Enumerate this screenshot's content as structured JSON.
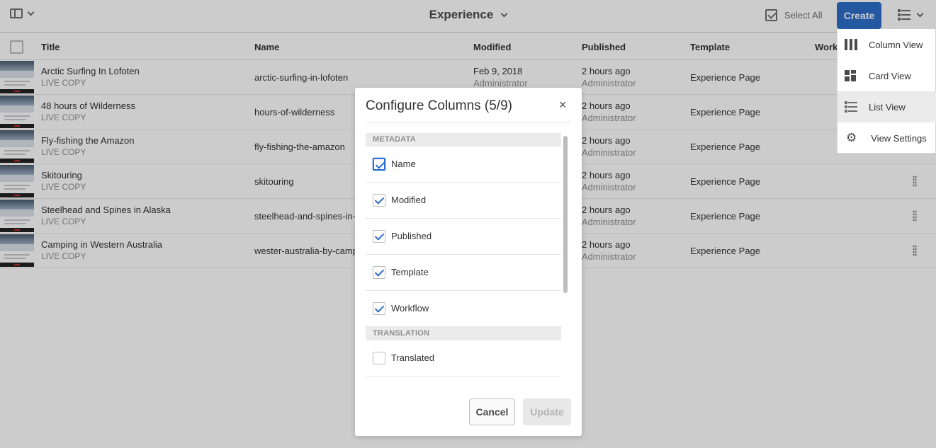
{
  "header": {
    "title": "Experience",
    "select_all": "Select All",
    "create": "Create"
  },
  "table": {
    "columns": [
      "Title",
      "Name",
      "Modified",
      "Published",
      "Template",
      "Workflow"
    ],
    "rows": [
      {
        "title": "Arctic Surfing In Lofoten",
        "sub": "LIVE COPY",
        "name": "arctic-surfing-in-lofoten",
        "modified": "Feb 9, 2018",
        "modified_by": "Administrator",
        "published": "2 hours ago",
        "published_by": "Administrator",
        "template": "Experience Page"
      },
      {
        "title": "48 hours of Wilderness",
        "sub": "LIVE COPY",
        "name": "hours-of-wilderness",
        "modified": "",
        "modified_by": "",
        "published": "2 hours ago",
        "published_by": "Administrator",
        "template": "Experience Page"
      },
      {
        "title": "Fly-fishing the Amazon",
        "sub": "LIVE COPY",
        "name": "fly-fishing-the-amazon",
        "modified": "",
        "modified_by": "",
        "published": "2 hours ago",
        "published_by": "Administrator",
        "template": "Experience Page"
      },
      {
        "title": "Skitouring",
        "sub": "LIVE COPY",
        "name": "skitouring",
        "modified": "",
        "modified_by": "",
        "published": "2 hours ago",
        "published_by": "Administrator",
        "template": "Experience Page"
      },
      {
        "title": "Steelhead and Spines in Alaska",
        "sub": "LIVE COPY",
        "name": "steelhead-and-spines-in-ala",
        "modified": "",
        "modified_by": "",
        "published": "2 hours ago",
        "published_by": "Administrator",
        "template": "Experience Page"
      },
      {
        "title": "Camping in Western Australia",
        "sub": "LIVE COPY",
        "name": "wester-australia-by-campe",
        "modified": "",
        "modified_by": "",
        "published": "2 hours ago",
        "published_by": "Administrator",
        "template": "Experience Page"
      }
    ]
  },
  "view_menu": {
    "items": [
      {
        "label": "Column View",
        "icon": "column-view-icon",
        "selected": false
      },
      {
        "label": "Card View",
        "icon": "card-view-icon",
        "selected": false
      },
      {
        "label": "List View",
        "icon": "list-view-icon",
        "selected": true
      },
      {
        "label": "View Settings",
        "icon": "gear-icon",
        "selected": false
      }
    ]
  },
  "dialog": {
    "title": "Configure Columns (5/9)",
    "close": "×",
    "sections": [
      {
        "label": "METADATA",
        "options": [
          {
            "label": "Name",
            "checked": true
          },
          {
            "label": "Modified",
            "checked": true
          },
          {
            "label": "Published",
            "checked": true
          },
          {
            "label": "Template",
            "checked": true
          },
          {
            "label": "Workflow",
            "checked": true
          }
        ]
      },
      {
        "label": "TRANSLATION",
        "options": [
          {
            "label": "Translated",
            "checked": false
          }
        ]
      }
    ],
    "cancel": "Cancel",
    "update": "Update"
  },
  "colors": {
    "accent": "#2d6fca",
    "overlay": "rgba(0,0,0,0.2)"
  }
}
